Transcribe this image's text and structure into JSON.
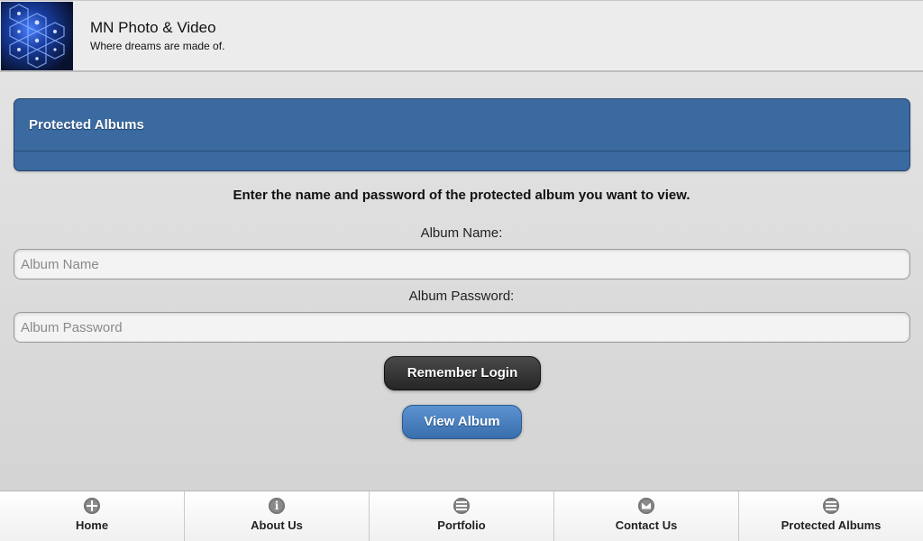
{
  "header": {
    "title": "MN Photo & Video",
    "tagline": "Where dreams are made of."
  },
  "panel": {
    "title": "Protected Albums"
  },
  "form": {
    "instructions": "Enter the name and password of the protected album you want to view.",
    "album_name_label": "Album Name:",
    "album_name_placeholder": "Album Name",
    "album_password_label": "Album Password:",
    "album_password_placeholder": "Album Password",
    "remember_label": "Remember Login",
    "view_label": "View Album"
  },
  "nav": {
    "items": [
      {
        "label": "Home",
        "icon": "grid-icon"
      },
      {
        "label": "About Us",
        "icon": "info-icon"
      },
      {
        "label": "Portfolio",
        "icon": "list-icon"
      },
      {
        "label": "Contact Us",
        "icon": "mail-icon"
      },
      {
        "label": "Protected Albums",
        "icon": "list-icon"
      }
    ]
  }
}
